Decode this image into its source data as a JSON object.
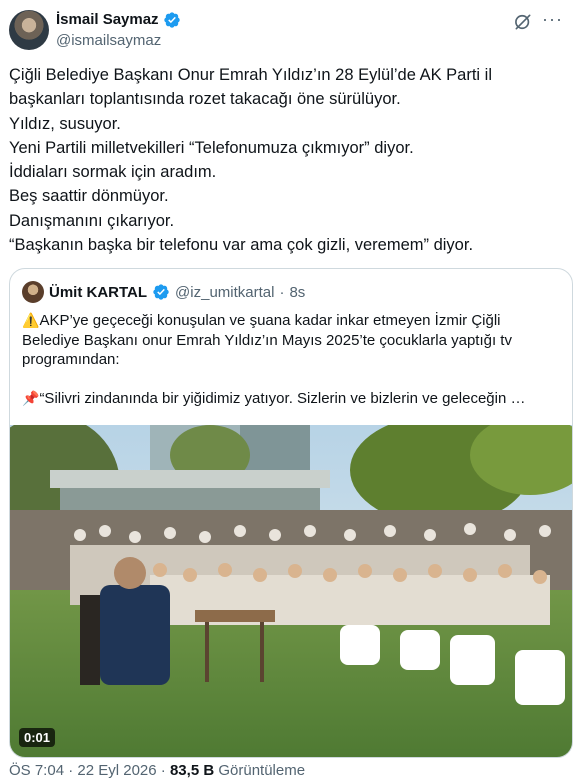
{
  "author": {
    "name": "İsmail Saymaz",
    "handle": "@ismailsaymaz"
  },
  "tweet": {
    "lines": [
      "Çiğli Belediye Başkanı Onur Emrah Yıldız’ın 28 Eylül’de AK Parti il",
      "başkanları toplantısında rozet takacağı öne sürülüyor.",
      "Yıldız, susuyor.",
      "Yeni Partili milletvekilleri “Telefonumuza çıkmıyor” diyor.",
      "İddiaları sormak için aradım.",
      "Beş saattir dönmüyor.",
      "Danışmanını çıkarıyor.",
      "“Başkanın başka bir telefonu var ama çok gizli, veremem” diyor."
    ]
  },
  "quote": {
    "name": "Ümit KARTAL",
    "handle": "@iz_umitkartal",
    "separator": "·",
    "time": "8s",
    "line1": "AKP’ye geçeceği konuşulan ve şuana kadar inkar etmeyen İzmir Çiğli",
    "line2": "Belediye Başkanı onur Emrah Yıldız’ın Mayıs 2025’te çocuklarla yaptığı tv",
    "line3": "programından:",
    "line4": "“Silivri zindanında bir yiğidimiz yatıyor. Sizlerin ve bizlerin ve geleceğin …",
    "emoji_warning": "⚠️",
    "emoji_pin": "📌"
  },
  "video": {
    "duration": "0:01"
  },
  "meta": {
    "time": "ÖS 7:04",
    "sep1": "·",
    "date": "22 Eyl 2026",
    "sep2": "·",
    "views": "83,5 B",
    "views_label": "Görüntüleme"
  },
  "colors": {
    "verified_blue": "#1d9bf0",
    "text": "#0f1419",
    "secondary": "#536471",
    "border": "#cfd9de"
  }
}
